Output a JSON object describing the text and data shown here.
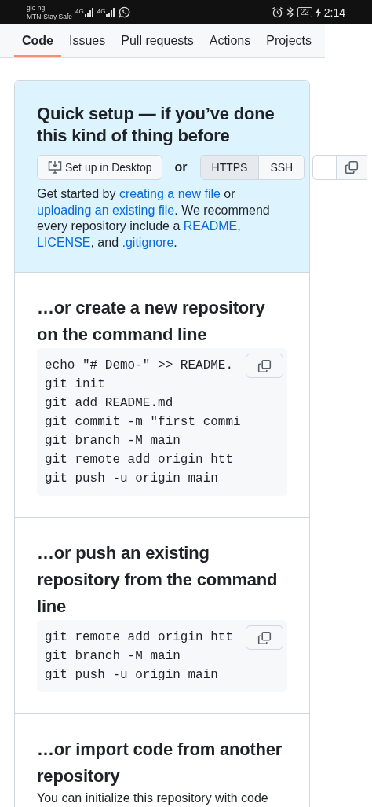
{
  "status_bar": {
    "carrier_1": "glo ng",
    "carrier_2": "MTN-Stay Safe",
    "network_1": "4G",
    "network_2": "4G",
    "battery": "22",
    "time": "2:14"
  },
  "tabs": [
    {
      "label": "Code",
      "selected": true
    },
    {
      "label": "Issues",
      "selected": false
    },
    {
      "label": "Pull requests",
      "selected": false
    },
    {
      "label": "Actions",
      "selected": false
    },
    {
      "label": "Projects",
      "selected": false
    }
  ],
  "quick_setup": {
    "title": "Quick setup — if you’ve done this kind of thing before",
    "desktop_button": "Set up in Desktop",
    "separator": "or",
    "protocols": [
      {
        "label": "HTTPS",
        "selected": true
      },
      {
        "label": "SSH",
        "selected": false
      }
    ],
    "intro": [
      {
        "kind": "text",
        "text": "Get started by "
      },
      {
        "kind": "link",
        "text": "creating a new file"
      },
      {
        "kind": "text",
        "text": " or "
      },
      {
        "kind": "link",
        "text": "uploading an existing file"
      },
      {
        "kind": "text",
        "text": ". We recommend every repository include a "
      },
      {
        "kind": "link",
        "text": "README"
      },
      {
        "kind": "text",
        "text": ", "
      },
      {
        "kind": "link",
        "text": "LICENSE"
      },
      {
        "kind": "text",
        "text": ", and "
      },
      {
        "kind": "link",
        "text": ".gitignore"
      },
      {
        "kind": "text",
        "text": "."
      }
    ]
  },
  "sections": [
    {
      "title": "…or create a new repository on the command line",
      "code": [
        "echo \"# Demo-\" >> README.",
        "git init",
        "git add README.md",
        "git commit -m \"first commi",
        "git branch -M main",
        "git remote add origin htt",
        "git push -u origin main"
      ]
    },
    {
      "title": "…or push an existing repository from the command line",
      "code": [
        "git remote add origin htt",
        "git branch -M main",
        "git push -u origin main"
      ]
    },
    {
      "title": "…or import code from another repository",
      "text": "You can initialize this repository with code"
    }
  ]
}
